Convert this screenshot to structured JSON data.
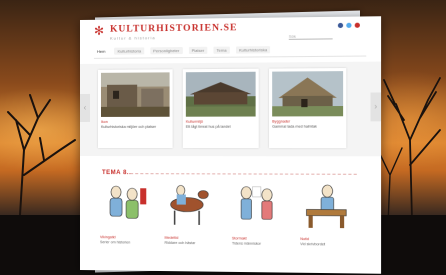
{
  "site": {
    "brand": "KULTURHISTORIEN.SE",
    "tagline": "Kultur & historia",
    "search_placeholder": "Sök",
    "social_colors": [
      "#3b5998",
      "#55acee",
      "#c8302c"
    ],
    "accent": "#c8302c"
  },
  "nav": {
    "items": [
      "Hem",
      "Kulturhistoria",
      "Personligheter",
      "Platser",
      "Tema",
      "Kulturhistoriska"
    ]
  },
  "slider": {
    "cards": [
      {
        "title": "Ikon",
        "text": "Kulturhistoriska miljöer och platser"
      },
      {
        "title": "Kulturmiljö",
        "text": "Ett lågt timrat hus på landet"
      },
      {
        "title": "Byggnader",
        "text": "Gammal lada med halmtak"
      }
    ]
  },
  "section": {
    "title": "TEMA 8..."
  },
  "cartoons": [
    {
      "title": "Vikingatid",
      "text": "Serier om historien"
    },
    {
      "title": "Medeltid",
      "text": "Riddare och hästar"
    },
    {
      "title": "Stormakt",
      "text": "Tidens människor"
    },
    {
      "title": "Nutid",
      "text": "Vid skrivbordet"
    }
  ]
}
